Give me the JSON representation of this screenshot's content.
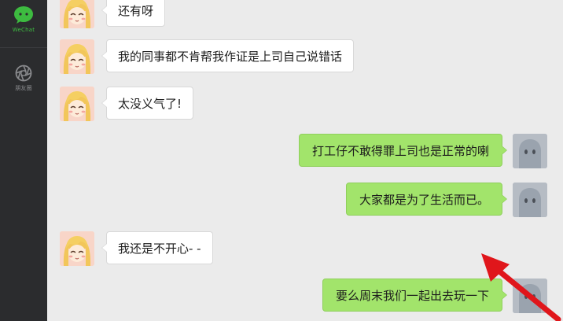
{
  "sidebar": {
    "wechat": {
      "label": "WeChat",
      "icon": "chat-icon"
    },
    "moments": {
      "label": "朋友圈",
      "icon": "aperture-icon"
    }
  },
  "messages": [
    {
      "side": "left",
      "text": "还有呀",
      "avatar": "cartoon-girl-avatar"
    },
    {
      "side": "left",
      "text": "我的同事都不肯帮我作证是上司自己说错话",
      "avatar": "cartoon-girl-avatar"
    },
    {
      "side": "left",
      "text": "太没义气了!",
      "avatar": "cartoon-girl-avatar"
    },
    {
      "side": "right",
      "text": "打工仔不敢得罪上司也是正常的喇",
      "avatar": "ghost-avatar"
    },
    {
      "side": "right",
      "text": "大家都是为了生活而已。",
      "avatar": "ghost-avatar"
    },
    {
      "side": "left",
      "text": "我还是不开心- -",
      "avatar": "cartoon-girl-avatar"
    },
    {
      "side": "right",
      "text": "要么周末我们一起出去玩一下",
      "avatar": "ghost-avatar"
    }
  ],
  "colors": {
    "sidebar_bg": "#2b2c2e",
    "chat_bg": "#ebebeb",
    "left_bubble": "#ffffff",
    "right_bubble": "#a2e46b",
    "accent_green": "#3dbb40",
    "annotation_arrow": "#e0161b"
  },
  "annotation": {
    "type": "arrow",
    "color": "#e0161b",
    "icon": "red-arrow-annotation"
  }
}
